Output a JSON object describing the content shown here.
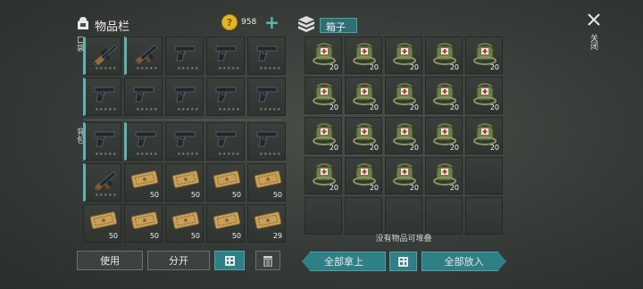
{
  "inventory": {
    "title": "物品栏",
    "coin_count": "958",
    "plus_label": "+",
    "pocket_label": "口袋",
    "backpack_label": "背包",
    "pocket_items": [
      {
        "icon": "sniper-rifle-icon",
        "stars": "★★★★★",
        "count": ""
      },
      {
        "icon": "assault-rifle-icon",
        "stars": "★★★★★",
        "count": ""
      },
      {
        "icon": "pistol-icon",
        "stars": "★★★★★",
        "count": ""
      },
      {
        "icon": "pistol-icon",
        "stars": "★★★★★",
        "count": ""
      },
      {
        "icon": "pistol-icon",
        "stars": "★★★★★",
        "count": ""
      },
      {
        "icon": "pistol-icon",
        "stars": "★★★★★",
        "count": ""
      },
      {
        "icon": "pistol-icon",
        "stars": "★★★★★",
        "count": ""
      },
      {
        "icon": "pistol-icon",
        "stars": "★★★★★",
        "count": ""
      },
      {
        "icon": "pistol-icon",
        "stars": "★★★★★",
        "count": ""
      },
      {
        "icon": "pistol-icon",
        "stars": "★★★★★",
        "count": ""
      }
    ],
    "backpack_items": [
      {
        "icon": "pistol-icon",
        "stars": "★★★★★",
        "count": ""
      },
      {
        "icon": "pistol-icon",
        "stars": "★★★★★",
        "count": ""
      },
      {
        "icon": "pistol-icon",
        "stars": "★★★★★",
        "count": ""
      },
      {
        "icon": "pistol-icon",
        "stars": "★★★★★",
        "count": ""
      },
      {
        "icon": "pistol-icon",
        "stars": "★★★★★",
        "count": ""
      },
      {
        "icon": "assault-rifle-icon",
        "stars": "★★★★★",
        "count": ""
      },
      {
        "icon": "ticket-icon",
        "stars": "",
        "count": "50"
      },
      {
        "icon": "ticket-icon",
        "stars": "",
        "count": "50"
      },
      {
        "icon": "ticket-icon",
        "stars": "",
        "count": "50"
      },
      {
        "icon": "ticket-icon",
        "stars": "",
        "count": "50"
      },
      {
        "icon": "ticket-icon",
        "stars": "",
        "count": "50"
      },
      {
        "icon": "ticket-icon",
        "stars": "",
        "count": "50"
      },
      {
        "icon": "ticket-icon",
        "stars": "",
        "count": "50"
      },
      {
        "icon": "ticket-icon",
        "stars": "",
        "count": "50"
      },
      {
        "icon": "ticket-icon",
        "stars": "",
        "count": "29"
      }
    ],
    "buttons": {
      "use": "使用",
      "split": "分开"
    }
  },
  "box": {
    "title": "箱子",
    "close_label": "关闭",
    "empty_text": "没有物品可堆叠",
    "items": [
      {
        "icon": "medkit-bag-icon",
        "count": "20"
      },
      {
        "icon": "medkit-bag-icon",
        "count": "20"
      },
      {
        "icon": "medkit-bag-icon",
        "count": "20"
      },
      {
        "icon": "medkit-bag-icon",
        "count": "20"
      },
      {
        "icon": "medkit-bag-icon",
        "count": "20"
      },
      {
        "icon": "medkit-bag-icon",
        "count": "20"
      },
      {
        "icon": "medkit-bag-icon",
        "count": "20"
      },
      {
        "icon": "medkit-bag-icon",
        "count": "20"
      },
      {
        "icon": "medkit-bag-icon",
        "count": "20"
      },
      {
        "icon": "medkit-bag-icon",
        "count": "20"
      },
      {
        "icon": "medkit-bag-icon",
        "count": "20"
      },
      {
        "icon": "medkit-bag-icon",
        "count": "20"
      },
      {
        "icon": "medkit-bag-icon",
        "count": "20"
      },
      {
        "icon": "medkit-bag-icon",
        "count": "20"
      },
      {
        "icon": "medkit-bag-icon",
        "count": "20"
      },
      {
        "icon": "medkit-bag-icon",
        "count": "20"
      },
      {
        "icon": "medkit-bag-icon",
        "count": "20"
      },
      {
        "icon": "medkit-bag-icon",
        "count": "20"
      },
      {
        "icon": "medkit-bag-icon",
        "count": "20"
      },
      {
        "icon": "",
        "count": ""
      },
      {
        "icon": "",
        "count": ""
      },
      {
        "icon": "",
        "count": ""
      },
      {
        "icon": "",
        "count": ""
      },
      {
        "icon": "",
        "count": ""
      },
      {
        "icon": "",
        "count": ""
      }
    ],
    "buttons": {
      "take_all": "全部拿上",
      "put_all": "全部放入"
    }
  },
  "colors": {
    "accent": "#2f7f86",
    "coin": "#e6b523",
    "plus": "#4fc1b5"
  }
}
